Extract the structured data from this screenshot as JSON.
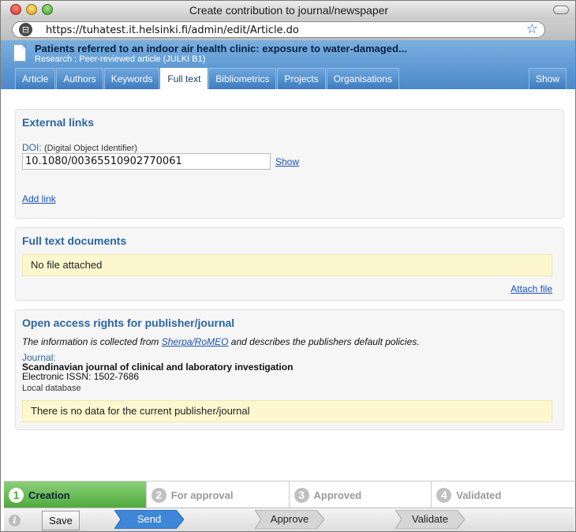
{
  "window": {
    "title": "Create contribution to journal/newspaper"
  },
  "browser": {
    "url": "https://tuhatest.it.helsinki.fi/admin/edit/Article.do"
  },
  "header": {
    "title": "Patients referred to an indoor air health clinic: exposure to water-damaged...",
    "subtitle": "Research : Peer-reviewed article (JULKI B1)"
  },
  "tabs": [
    {
      "label": "Article"
    },
    {
      "label": "Authors"
    },
    {
      "label": "Keywords"
    },
    {
      "label": "Full text",
      "active": true
    },
    {
      "label": "Bibliometrics"
    },
    {
      "label": "Projects"
    },
    {
      "label": "Organisations"
    }
  ],
  "tab_show": "Show",
  "external_links": {
    "title": "External links",
    "doi_label": "DOI:",
    "doi_hint": "(Digital Object Identifier)",
    "doi_value": "10.1080/00365510902770061",
    "show_link": "Show",
    "add_link": "Add link"
  },
  "full_text": {
    "title": "Full text documents",
    "notice": "No file attached",
    "attach_link": "Attach file"
  },
  "open_access": {
    "title": "Open access rights for publisher/journal",
    "note_before": "The information is collected from ",
    "note_link": "Sherpa/RoMEO",
    "note_after": " and describes the publishers default policies.",
    "journal_label": "Journal:",
    "journal_name": "Scandinavian journal of clinical and laboratory investigation",
    "issn": "Electronic ISSN: 1502-7686",
    "source": "Local database",
    "notice": "There is no data for the current publisher/journal"
  },
  "workflow": [
    {
      "num": "1",
      "label": "Creation",
      "active": true
    },
    {
      "num": "2",
      "label": "For approval"
    },
    {
      "num": "3",
      "label": "Approved"
    },
    {
      "num": "4",
      "label": "Validated"
    }
  ],
  "actions": {
    "info_glyph": "i",
    "save": "Save",
    "send": "Send",
    "approve": "Approve",
    "validate": "Validate"
  },
  "colors": {
    "header_blue": "#4b88c9",
    "panel_title": "#2a65a5",
    "notice_bg": "#fdf7cf",
    "step_active": "#4ea93b",
    "send_blue": "#3d86d8"
  }
}
